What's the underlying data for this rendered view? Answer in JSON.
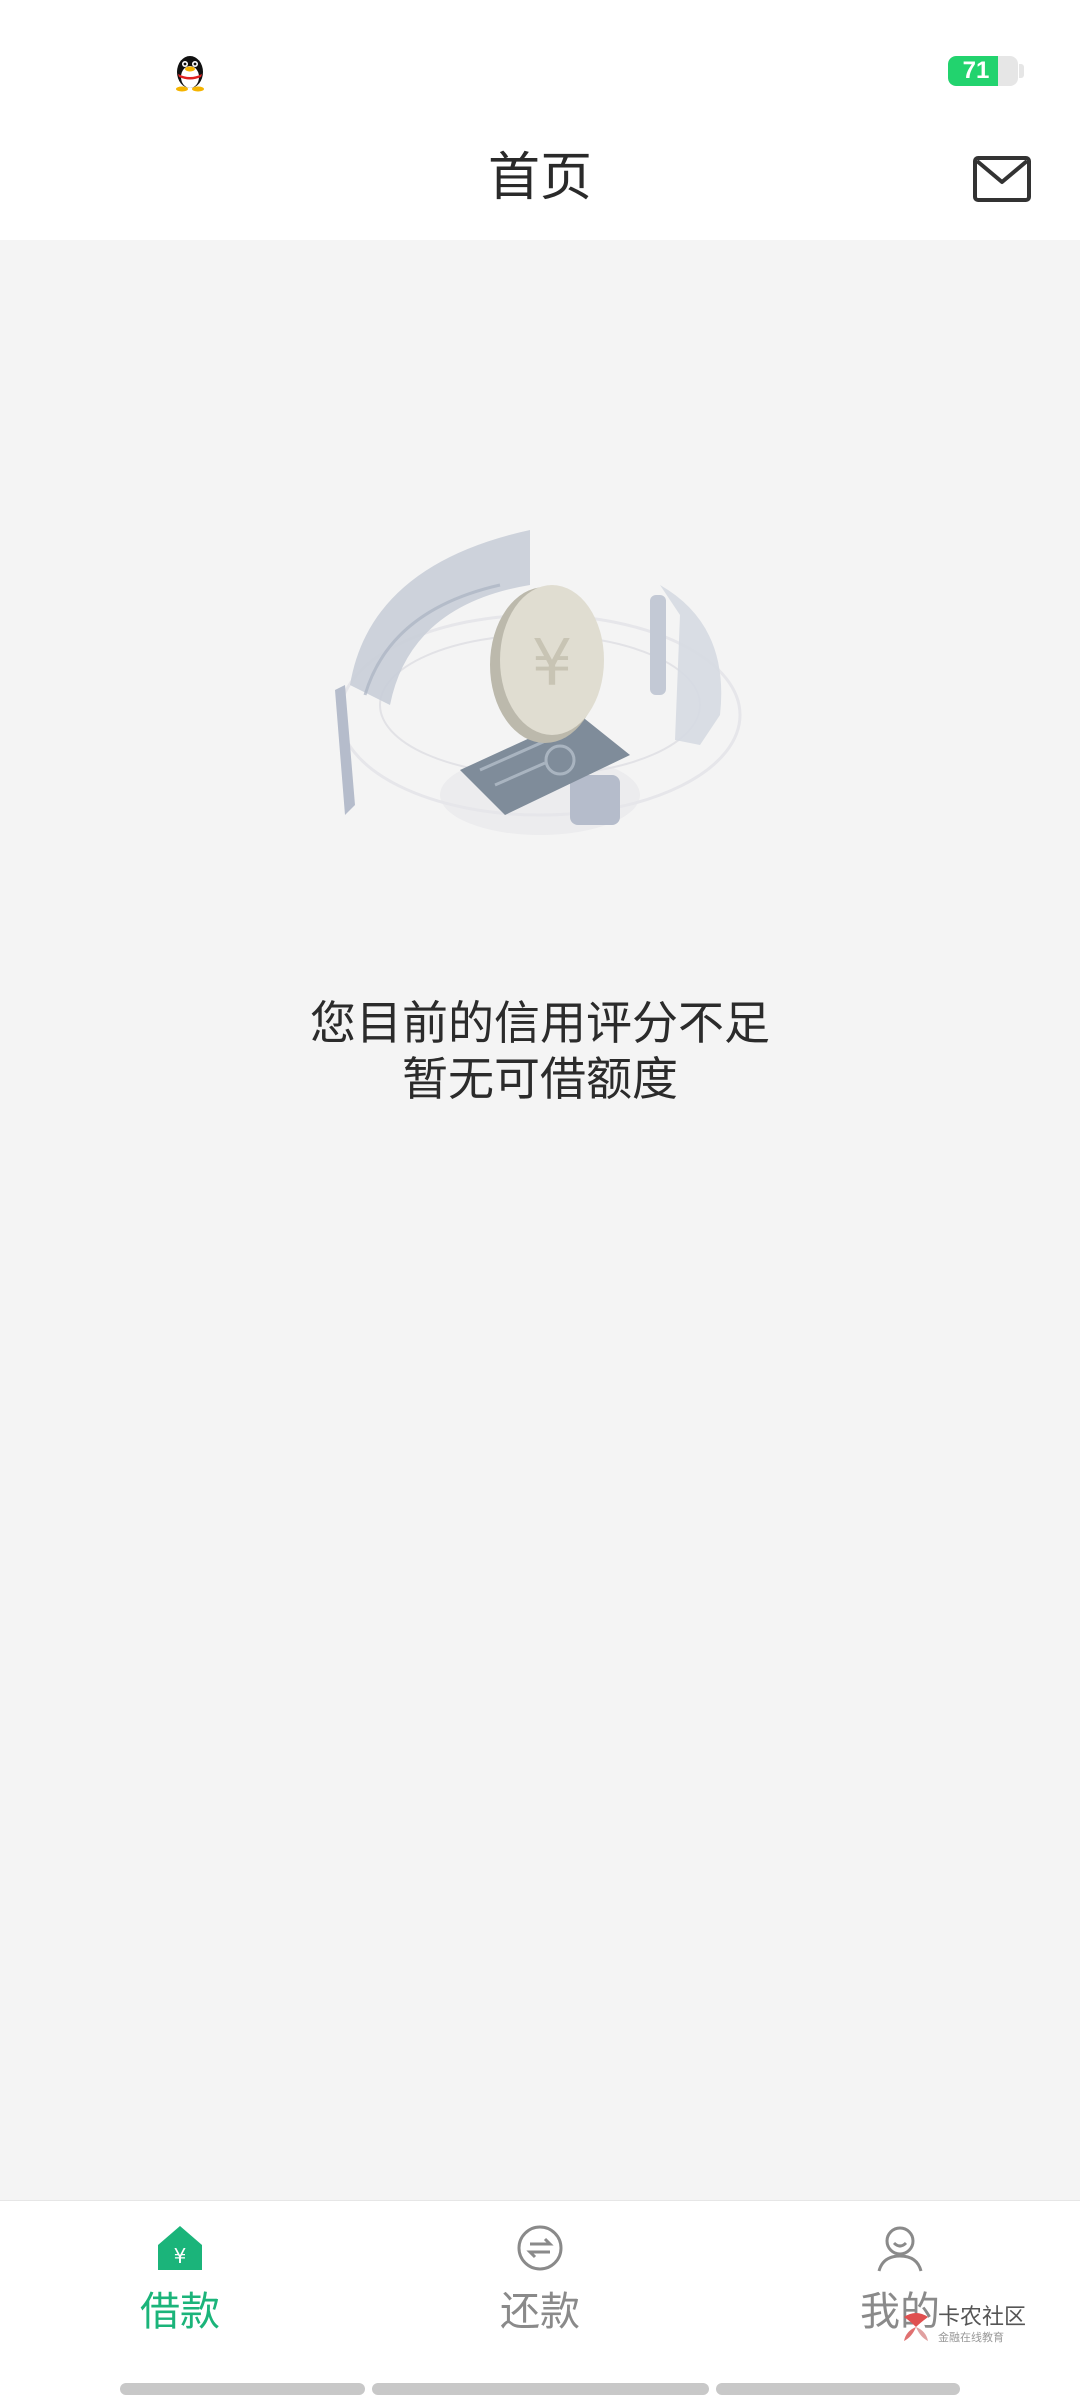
{
  "status_bar": {
    "battery_level": "71",
    "battery_fraction": 0.71,
    "battery_color": "#22d36e",
    "left_icon": "qq-penguin-icon"
  },
  "header": {
    "title": "首页",
    "right_icon": "mail-icon"
  },
  "empty_state": {
    "illustration": "coin-credit-card-illustration",
    "line1": "您目前的信用评分不足",
    "line2": "暂无可借额度"
  },
  "tabs": [
    {
      "label": "借款",
      "icon": "loan-home-icon",
      "active": true
    },
    {
      "label": "还款",
      "icon": "repay-exchange-icon",
      "active": false
    },
    {
      "label": "我的",
      "icon": "profile-icon",
      "active": false
    }
  ],
  "watermark": {
    "title": "卡农社区",
    "subtitle": "金融在线教育"
  },
  "colors": {
    "accent": "#1bb47a",
    "inactive": "#8a8a8a",
    "background": "#f4f4f4"
  }
}
